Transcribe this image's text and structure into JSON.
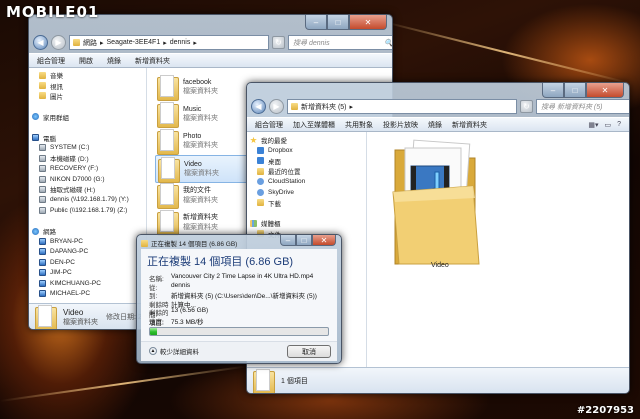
{
  "watermark": {
    "logo": "MOBILE01",
    "id": "#2207953"
  },
  "colors": {
    "accent": "#3c78c8",
    "progress_fill": "#2cbf2c",
    "close_button": "#c44b2c"
  },
  "window1": {
    "breadcrumb": [
      "網路",
      "Seagate-3EE4F1",
      "dennis"
    ],
    "search_placeholder": "搜尋 dennis",
    "toolbar": [
      "組合管理",
      "開啟",
      "燒錄",
      "新增資料夾"
    ],
    "nav": [
      {
        "label": "音樂",
        "icon": "music-icon",
        "head": false
      },
      {
        "label": "視訊",
        "icon": "video-icon",
        "head": false
      },
      {
        "label": "圖片",
        "icon": "picture-icon",
        "head": false
      },
      {
        "label": "",
        "icon": "",
        "head": false
      },
      {
        "label": "家用群組",
        "icon": "homegroup-icon",
        "head": true
      },
      {
        "label": "",
        "icon": "",
        "head": false
      },
      {
        "label": "電腦",
        "icon": "computer-icon",
        "head": true
      },
      {
        "label": "SYSTEM (C:)",
        "icon": "drive-icon",
        "head": false
      },
      {
        "label": "本機磁碟 (D:)",
        "icon": "drive-icon",
        "head": false
      },
      {
        "label": "RECOVERY (F:)",
        "icon": "drive-icon",
        "head": false
      },
      {
        "label": "NIKON D7000 (G:)",
        "icon": "drive-icon",
        "head": false
      },
      {
        "label": "抽取式磁碟 (H:)",
        "icon": "drive-icon",
        "head": false
      },
      {
        "label": "dennis (\\\\192.168.1.79) (Y:)",
        "icon": "network-drive-icon",
        "head": false
      },
      {
        "label": "Public (\\\\192.168.1.79) (Z:)",
        "icon": "network-drive-icon",
        "head": false
      },
      {
        "label": "",
        "icon": "",
        "head": false
      },
      {
        "label": "網路",
        "icon": "network-icon",
        "head": true
      },
      {
        "label": "BRYAN-PC",
        "icon": "computer-icon",
        "head": false
      },
      {
        "label": "DAPANG-PC",
        "icon": "computer-icon",
        "head": false
      },
      {
        "label": "DEN-PC",
        "icon": "computer-icon",
        "head": false
      },
      {
        "label": "JIM-PC",
        "icon": "computer-icon",
        "head": false
      },
      {
        "label": "KIMCHUANG-PC",
        "icon": "computer-icon",
        "head": false
      },
      {
        "label": "MICHAEL-PC",
        "icon": "computer-icon",
        "head": false
      }
    ],
    "files": [
      {
        "name": "facebook",
        "type": "檔案資料夾"
      },
      {
        "name": "Music",
        "type": "檔案資料夾"
      },
      {
        "name": "Photo",
        "type": "檔案資料夾"
      },
      {
        "name": "Video",
        "type": "檔案資料夾"
      },
      {
        "name": "我的文件",
        "type": "檔案資料夾"
      },
      {
        "name": "新增資料夾",
        "type": "檔案資料夾"
      }
    ],
    "status": {
      "name": "Video",
      "detail": "修改日期: 201",
      "type": "檔案資料夾"
    }
  },
  "window2": {
    "breadcrumb": [
      "新增資料夾 (5)"
    ],
    "search_placeholder": "搜尋 新增資料夾 (5)",
    "toolbar": [
      "組合管理",
      "加入至媒體櫃",
      "共用對象",
      "投影片放映",
      "燒錄",
      "新增資料夾"
    ],
    "nav": [
      {
        "label": "我的最愛",
        "icon": "favorites-star-icon",
        "head": true
      },
      {
        "label": "Dropbox",
        "icon": "dropbox-icon",
        "head": false
      },
      {
        "label": "桌面",
        "icon": "desktop-icon",
        "head": false
      },
      {
        "label": "最近的位置",
        "icon": "recent-places-icon",
        "head": false
      },
      {
        "label": "CloudStation",
        "icon": "cloudstation-icon",
        "head": false
      },
      {
        "label": "SkyDrive",
        "icon": "skydrive-icon",
        "head": false
      },
      {
        "label": "下載",
        "icon": "downloads-icon",
        "head": false
      },
      {
        "label": "",
        "icon": "",
        "head": false
      },
      {
        "label": "媒體櫃",
        "icon": "libraries-icon",
        "head": true
      },
      {
        "label": "文件",
        "icon": "documents-icon",
        "head": false
      }
    ],
    "item": {
      "name": "Video"
    },
    "status": "1 個項目"
  },
  "dialog": {
    "window_title": "正在複製 14 個項目 (6.86 GB)",
    "heading": "正在複製 14 個項目 (6.86 GB)",
    "details": [
      {
        "key": "名稱:",
        "value": "Vancouver City 2 Time Lapse in 4K Ultra HD.mp4"
      },
      {
        "key": "從:",
        "value": "dennis"
      },
      {
        "key": "到:",
        "value": "新增資料夾 (5) (C:\\Users\\den\\De...\\新增資料夾 (5))"
      },
      {
        "key": "剩餘時間:",
        "value": "計算中..."
      },
      {
        "key": "剩餘的項目:",
        "value": "13 (6.56 GB)"
      },
      {
        "key": "速度:",
        "value": "75.3 MB/秒"
      }
    ],
    "progress_fraction": 0.04,
    "less_details": "較少詳細資料",
    "cancel": "取消"
  }
}
